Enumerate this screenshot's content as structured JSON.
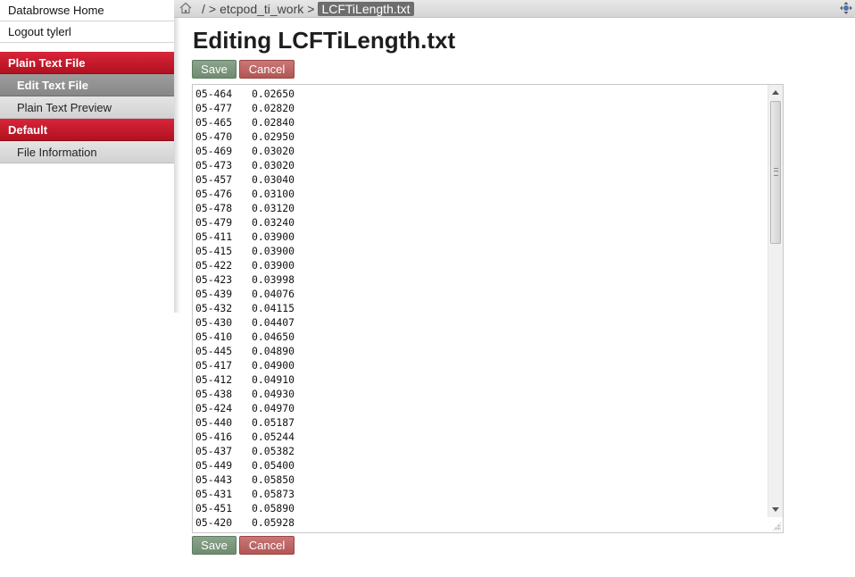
{
  "sidebar": {
    "home_label": "Databrowse Home",
    "logout_label": "Logout tylerl",
    "sections": [
      {
        "title": "Plain Text File",
        "items": [
          "Edit Text File",
          "Plain Text Preview"
        ]
      },
      {
        "title": "Default",
        "items": [
          "File Information"
        ]
      }
    ]
  },
  "breadcrumb": {
    "root": "/",
    "sep": ">",
    "dir": "etcpod_ti_work",
    "current": "LCFTiLength.txt"
  },
  "page_title": "Editing LCFTiLength.txt",
  "buttons": {
    "save": "Save",
    "cancel": "Cancel"
  },
  "file_lines": [
    [
      "05-464",
      "0.02650"
    ],
    [
      "05-477",
      "0.02820"
    ],
    [
      "05-465",
      "0.02840"
    ],
    [
      "05-470",
      "0.02950"
    ],
    [
      "05-469",
      "0.03020"
    ],
    [
      "05-473",
      "0.03020"
    ],
    [
      "05-457",
      "0.03040"
    ],
    [
      "05-476",
      "0.03100"
    ],
    [
      "05-478",
      "0.03120"
    ],
    [
      "05-479",
      "0.03240"
    ],
    [
      "05-411",
      "0.03900"
    ],
    [
      "05-415",
      "0.03900"
    ],
    [
      "05-422",
      "0.03900"
    ],
    [
      "05-423",
      "0.03998"
    ],
    [
      "05-439",
      "0.04076"
    ],
    [
      "05-432",
      "0.04115"
    ],
    [
      "05-430",
      "0.04407"
    ],
    [
      "05-410",
      "0.04650"
    ],
    [
      "05-445",
      "0.04890"
    ],
    [
      "05-417",
      "0.04900"
    ],
    [
      "05-412",
      "0.04910"
    ],
    [
      "05-438",
      "0.04930"
    ],
    [
      "05-424",
      "0.04970"
    ],
    [
      "05-440",
      "0.05187"
    ],
    [
      "05-416",
      "0.05244"
    ],
    [
      "05-437",
      "0.05382"
    ],
    [
      "05-449",
      "0.05400"
    ],
    [
      "05-443",
      "0.05850"
    ],
    [
      "05-431",
      "0.05873"
    ],
    [
      "05-451",
      "0.05890"
    ],
    [
      "05-420",
      "0.05928"
    ]
  ],
  "icons": {
    "home": "home-icon",
    "move": "move-icon"
  },
  "colors": {
    "section": "#c41a2c",
    "save": "#7b977c",
    "cancel": "#c0605f"
  }
}
